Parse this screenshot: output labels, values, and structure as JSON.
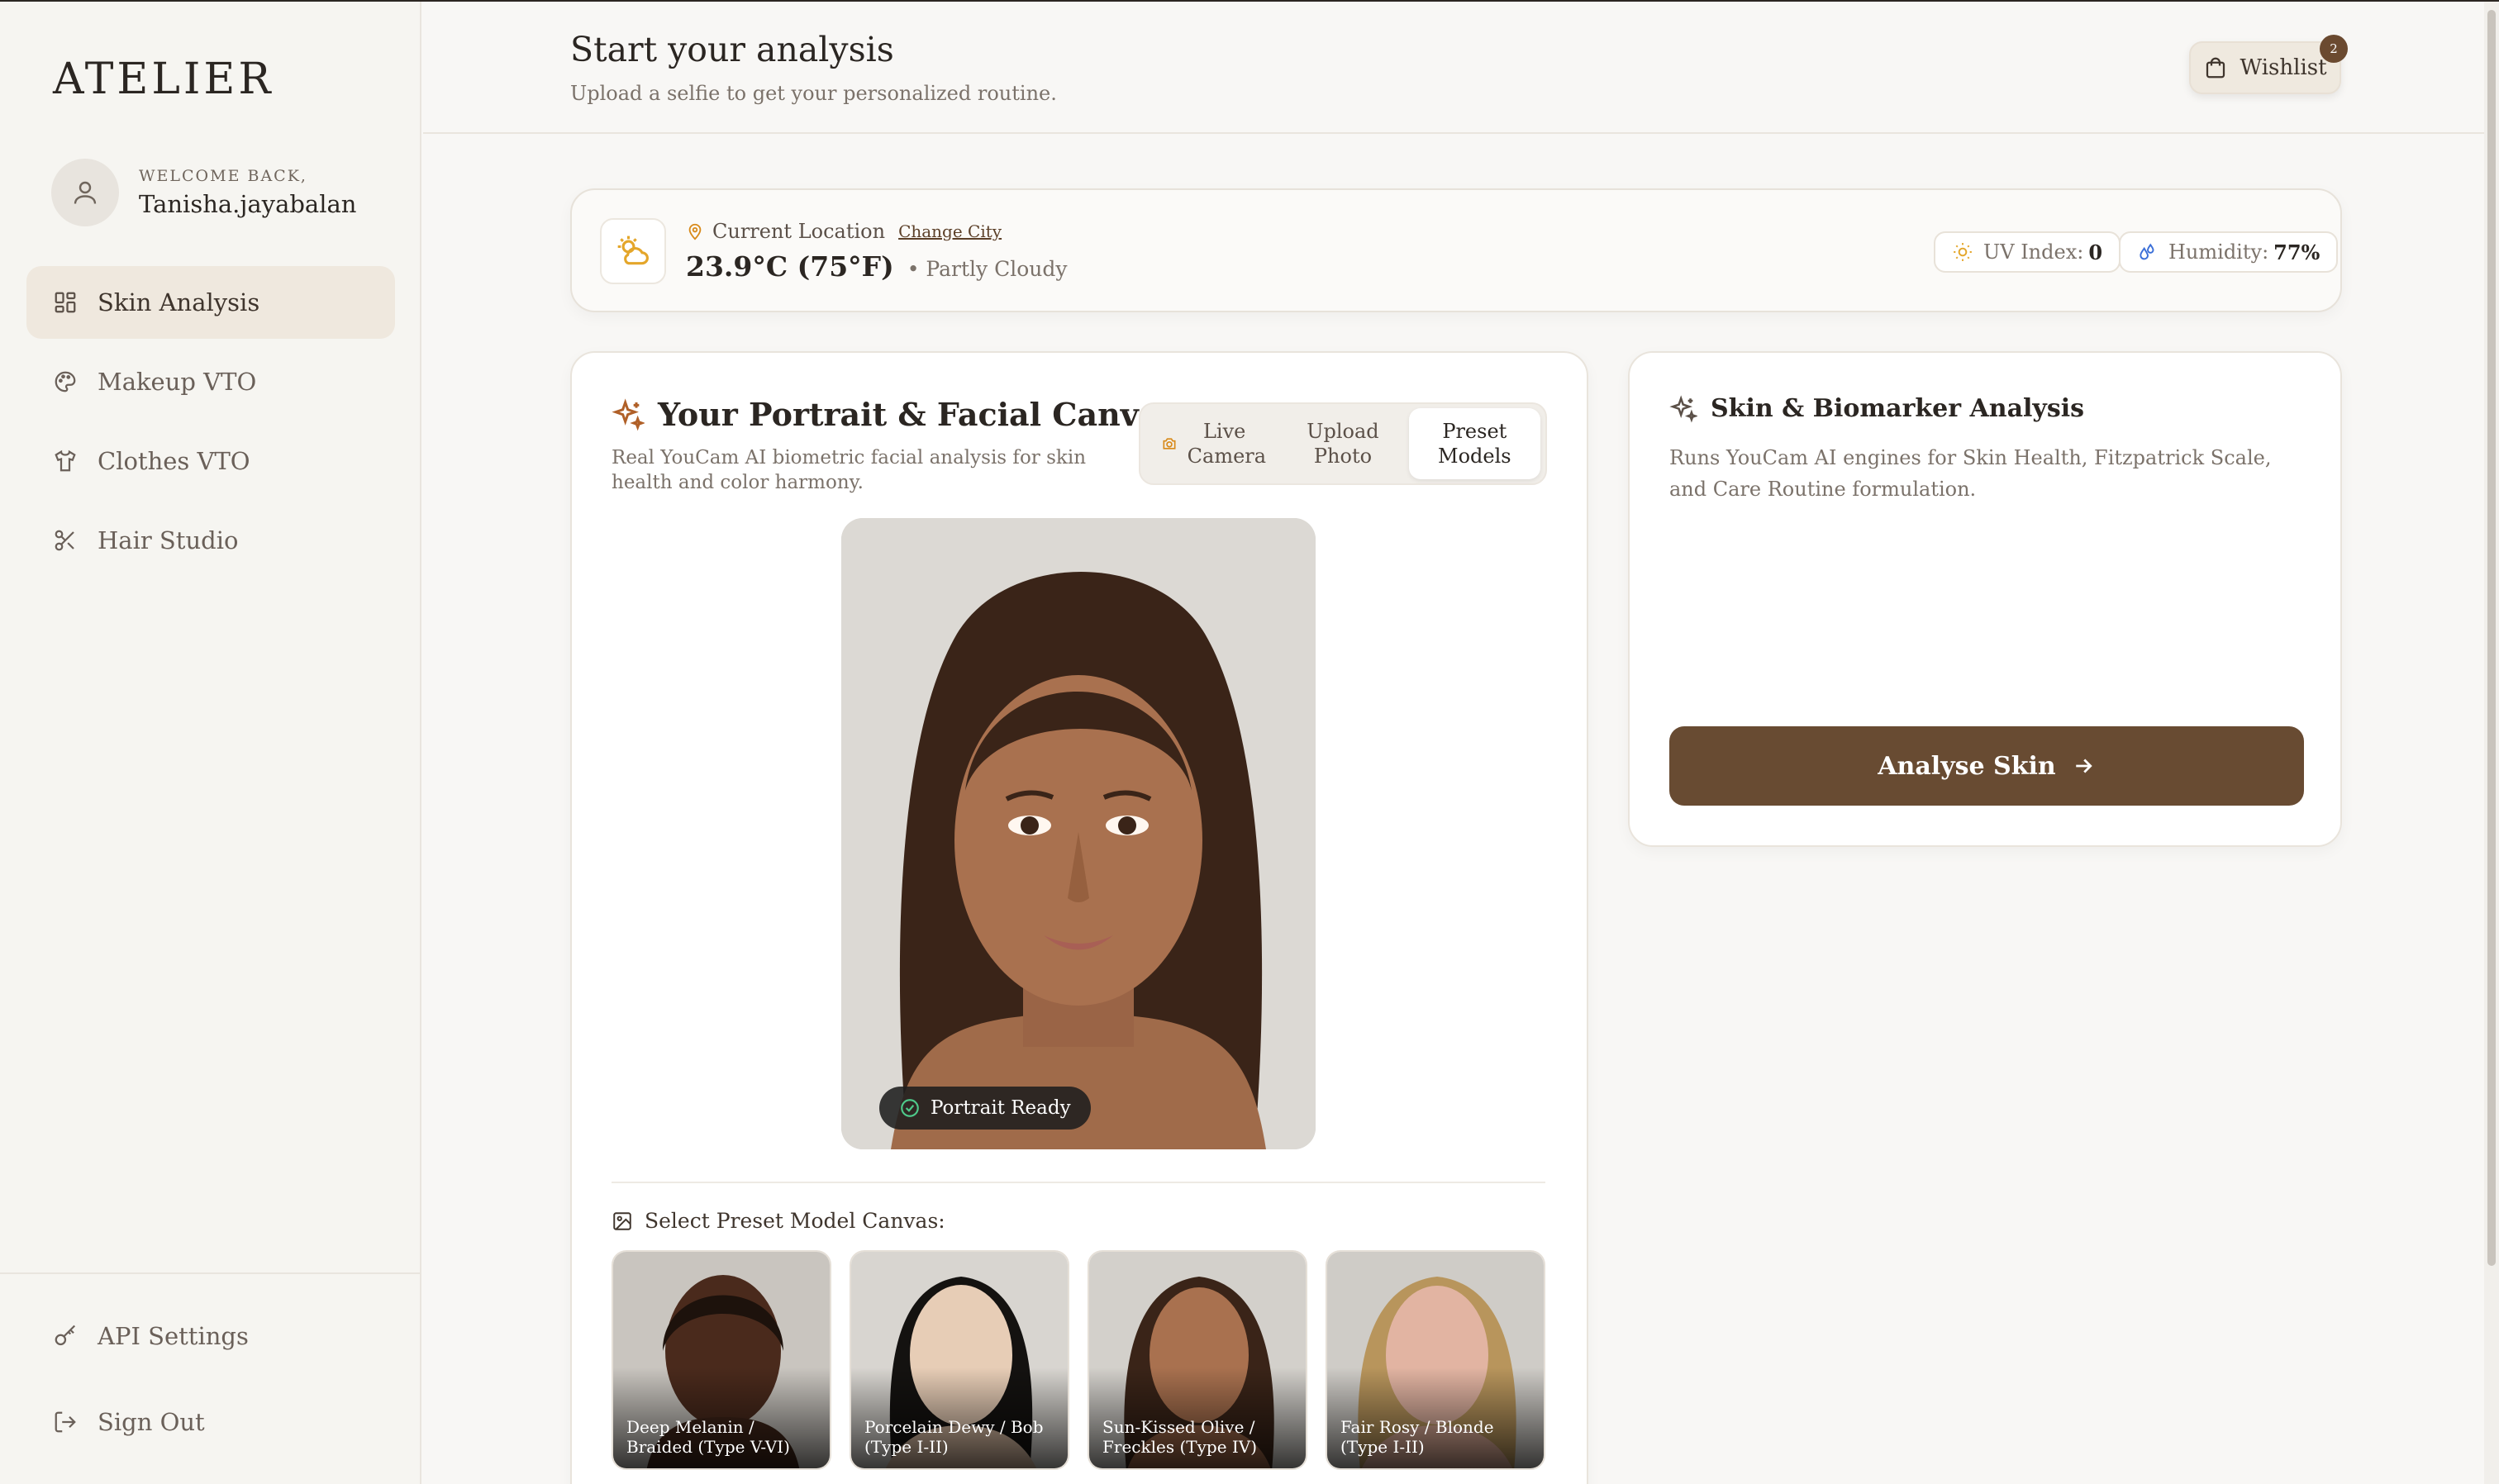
{
  "app": {
    "brand": "ATELIER"
  },
  "profile": {
    "welcome": "WELCOME BACK,",
    "username": "Tanisha.jayabalan"
  },
  "nav": {
    "items": [
      {
        "label": "Skin Analysis",
        "icon": "grid-icon",
        "active": true
      },
      {
        "label": "Makeup VTO",
        "icon": "palette-icon",
        "active": false
      },
      {
        "label": "Clothes VTO",
        "icon": "shirt-icon",
        "active": false
      },
      {
        "label": "Hair Studio",
        "icon": "scissors-icon",
        "active": false
      }
    ],
    "bottom": [
      {
        "label": "API Settings",
        "icon": "key-icon"
      },
      {
        "label": "Sign Out",
        "icon": "logout-icon"
      }
    ]
  },
  "header": {
    "title": "Start your analysis",
    "subtitle": "Upload a selfie to get your personalized routine.",
    "wishlist_label": "Wishlist",
    "wishlist_count": "2"
  },
  "weather": {
    "location_label": "Current Location",
    "change_city": "Change City",
    "temperature": "23.9°C (75°F)",
    "condition": "• Partly Cloudy",
    "uv_label": "UV Index:",
    "uv_value": "0",
    "humidity_label": "Humidity:",
    "humidity_value": "77%"
  },
  "canvas": {
    "title": "Your Portrait & Facial Canvas",
    "description": "Real YouCam AI biometric facial analysis for skin health and color harmony.",
    "tabs": [
      {
        "label": "Live Camera",
        "active": false
      },
      {
        "label": "Upload Photo",
        "active": false
      },
      {
        "label": "Preset Models",
        "active": true
      }
    ],
    "status": "Portrait Ready",
    "preset_label": "Select Preset Model Canvas:",
    "presets": [
      {
        "caption": "Deep Melanin / Braided (Type V-VI)"
      },
      {
        "caption": "Porcelain Dewy / Bob (Type I-II)"
      },
      {
        "caption": "Sun-Kissed Olive / Freckles (Type IV)"
      },
      {
        "caption": "Fair Rosy / Blonde (Type I-II)"
      }
    ]
  },
  "biomarker": {
    "title": "Skin & Biomarker Analysis",
    "description": "Runs YouCam AI engines for Skin Health, Fitzpatrick Scale, and Care Routine formulation.",
    "button_label": "Analyse Skin"
  },
  "colors": {
    "accent": "#684b32",
    "active_nav": "#efe8de",
    "background": "#f8f7f5",
    "uv_icon": "#e4a62a",
    "humidity_icon": "#3b6fd8",
    "location_icon": "#d88a1a"
  }
}
